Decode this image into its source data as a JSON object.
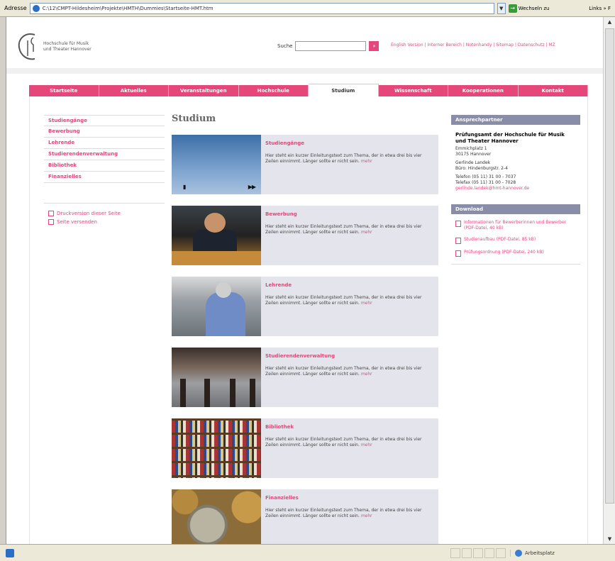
{
  "browser": {
    "address_label": "Adresse",
    "url": "C:\\12\\CMPT-Hildesheim\\Projekte\\HMTH\\Dummies\\Startseite-HMT.htm",
    "go_label": "Wechseln zu",
    "toolbar_links": "Links  »  F",
    "status_zone": "Arbeitsplatz"
  },
  "site": {
    "logo_text": "Hochschule für Musik und Theater Hannover",
    "search_label": "Suche",
    "search_value": "",
    "search_button": "»",
    "meta_links": "English Version | Interner Bereich | Notenhandy | Sitemap | Datenschutz | MZ"
  },
  "mainnav": [
    {
      "label": "Startseite"
    },
    {
      "label": "Aktuelles"
    },
    {
      "label": "Veranstaltungen"
    },
    {
      "label": "Hochschule"
    },
    {
      "label": "Studium"
    },
    {
      "label": "Wissenschaft"
    },
    {
      "label": "Kooperationen"
    },
    {
      "label": "Kontakt"
    }
  ],
  "leftnav": [
    {
      "label": "Studiengänge"
    },
    {
      "label": "Bewerbung"
    },
    {
      "label": "Lehrende"
    },
    {
      "label": "Studierendenverwaltung"
    },
    {
      "label": "Bibliothek"
    },
    {
      "label": "Finanzielles"
    }
  ],
  "tools": [
    {
      "label": "Druckversion dieser Seite"
    },
    {
      "label": "Seite versenden"
    }
  ],
  "main": {
    "title": "Studium",
    "teasers": [
      {
        "title": "Studiengänge",
        "text": "Hier steht ein kurzer Einleitungstext zum Thema, der in etwa drei bis vier Zeilen einnimmt. Länger sollte er nicht sein.",
        "more": "mehr"
      },
      {
        "title": "Bewerbung",
        "text": "Hier steht ein kurzer Einleitungstext zum Thema, der in etwa drei bis vier Zeilen einnimmt. Länger sollte er nicht sein.",
        "more": "mehr"
      },
      {
        "title": "Lehrende",
        "text": "Hier steht ein kurzer Einleitungstext zum Thema, der in etwa drei bis vier Zeilen einnimmt. Länger sollte er nicht sein.",
        "more": "mehr"
      },
      {
        "title": "Studierendenverwaltung",
        "text": "Hier steht ein kurzer Einleitungstext zum Thema, der in etwa drei bis vier Zeilen einnimmt. Länger sollte er nicht sein.",
        "more": "mehr"
      },
      {
        "title": "Bibliothek",
        "text": "Hier steht ein kurzer Einleitungstext zum Thema, der in etwa drei bis vier Zeilen einnimmt. Länger sollte er nicht sein.",
        "more": "mehr"
      },
      {
        "title": "Finanzielles",
        "text": "Hier steht ein kurzer Einleitungstext zum Thema, der in etwa drei bis vier Zeilen einnimmt. Länger sollte er nicht sein.",
        "more": "mehr"
      }
    ]
  },
  "contact": {
    "heading": "Ansprechpartner",
    "name": "Prüfungsamt der Hochschule für Musik und Theater Hannover",
    "street": "Emmichplatz 1",
    "city": "30175 Hannover",
    "person": "Gerlinde Landek",
    "room": "Büro: Hindenburgstr. 2-4",
    "phone1": "Telefon (05 11) 31 00 - 7037",
    "phone2": "Telefax (05 11) 31 00 - 7028",
    "email": "gerlinde.landek@hmt-hannover.de"
  },
  "downloads": {
    "heading": "Download",
    "items": [
      {
        "label": "Informationen für Bewerberinnen und Bewerber (PDF-Datei, 40 kB)"
      },
      {
        "label": "Studienaufbau (PDF-Datei, 85 kB)"
      },
      {
        "label": "Prüfungsordnung (PDF-Datei, 240 kB)"
      }
    ]
  }
}
